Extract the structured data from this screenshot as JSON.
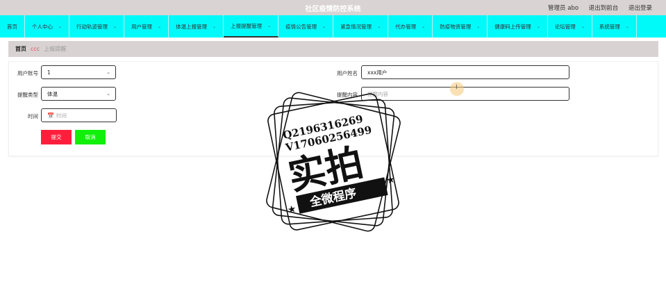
{
  "header": {
    "title": "社区疫情防控系统",
    "user_label": "管理员 abo",
    "to_front": "退出到前台",
    "logout": "退出登录"
  },
  "nav": {
    "items": [
      {
        "label": "首页",
        "has_menu": false
      },
      {
        "label": "个人中心",
        "has_menu": true
      },
      {
        "label": "行动轨迹管理",
        "has_menu": true
      },
      {
        "label": "用户管理",
        "has_menu": true
      },
      {
        "label": "体温上报管理",
        "has_menu": true
      },
      {
        "label": "上报提醒管理",
        "has_menu": true,
        "active": true
      },
      {
        "label": "疫情公告管理",
        "has_menu": true
      },
      {
        "label": "紧急情况管理",
        "has_menu": true
      },
      {
        "label": "代办管理",
        "has_menu": true
      },
      {
        "label": "防疫物资管理",
        "has_menu": true
      },
      {
        "label": "健康码上传管理",
        "has_menu": true
      },
      {
        "label": "论坛管理",
        "has_menu": true
      },
      {
        "label": "系统管理",
        "has_menu": true
      }
    ]
  },
  "breadcrumb": {
    "home": "首页",
    "separator": "ccc",
    "current": "上报提醒"
  },
  "form": {
    "account_label": "用户账号",
    "account_value": "1",
    "name_label": "用户姓名",
    "name_value": "xxx用户",
    "type_label": "提醒类型",
    "type_value": "体温",
    "content_label": "提醒内容",
    "content_placeholder": "提醒内容",
    "time_label": "时间",
    "time_placeholder": "时间",
    "submit": "提交",
    "cancel": "取消"
  },
  "watermark": {
    "line1": "Q2196316269",
    "line2": "V17060256499",
    "big": "实拍",
    "ribbon": "全微程序"
  },
  "cursor": {
    "marker": "I"
  },
  "colors": {
    "nav_bg": "#00fafa",
    "submit": "#ff1f3d",
    "cancel": "#10f00a",
    "header_bg": "#d9d3d3"
  }
}
